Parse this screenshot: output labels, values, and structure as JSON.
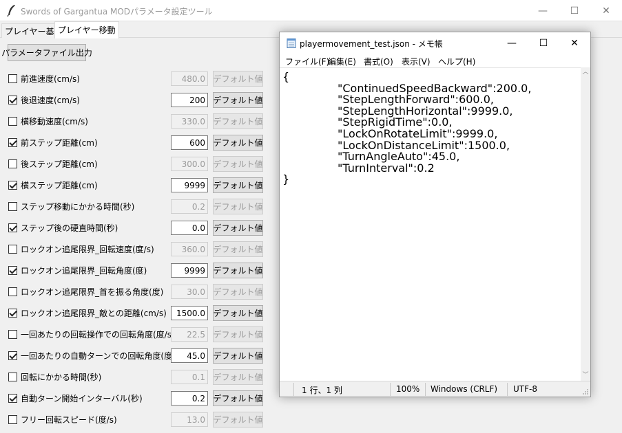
{
  "app": {
    "title": "Swords of Gargantua MODパラメータ設定ツール",
    "minimize": "—",
    "maximize": "☐",
    "close": "✕"
  },
  "tabs": [
    {
      "label": "プレイヤー基礎"
    },
    {
      "label": "プレイヤー移動"
    }
  ],
  "export_button": "パラメータファイル出力",
  "default_label": "デフォルト値",
  "params": [
    {
      "label": "前進速度(cm/s)",
      "checked": false,
      "value": "480.0"
    },
    {
      "label": "後退速度(cm/s)",
      "checked": true,
      "value": "200"
    },
    {
      "label": "横移動速度(cm/s)",
      "checked": false,
      "value": "330.0"
    },
    {
      "label": "前ステップ距離(cm)",
      "checked": true,
      "value": "600"
    },
    {
      "label": "後ステップ距離(cm)",
      "checked": false,
      "value": "300.0"
    },
    {
      "label": "横ステップ距離(cm)",
      "checked": true,
      "value": "9999"
    },
    {
      "label": "ステップ移動にかかる時間(秒)",
      "checked": false,
      "value": "0.2"
    },
    {
      "label": "ステップ後の硬直時間(秒)",
      "checked": true,
      "value": "0.0"
    },
    {
      "label": "ロックオン追尾限界_回転速度(度/s)",
      "checked": false,
      "value": "360.0"
    },
    {
      "label": "ロックオン追尾限界_回転角度(度)",
      "checked": true,
      "value": "9999"
    },
    {
      "label": "ロックオン追尾限界_首を振る角度(度)",
      "checked": false,
      "value": "30.0"
    },
    {
      "label": "ロックオン追尾限界_敵との距離(cm/s)",
      "checked": true,
      "value": "1500.0"
    },
    {
      "label": "一回あたりの回転操作での回転角度(度/s)",
      "checked": false,
      "value": "22.5"
    },
    {
      "label": "一回あたりの自動ターンでの回転角度(度/s)",
      "checked": true,
      "value": "45.0"
    },
    {
      "label": "回転にかかる時間(秒)",
      "checked": false,
      "value": "0.1"
    },
    {
      "label": "自動ターン開始インターバル(秒)",
      "checked": true,
      "value": "0.2"
    },
    {
      "label": "フリー回転スピード(度/s)",
      "checked": false,
      "value": "13.0"
    }
  ],
  "notepad": {
    "title": "playermovement_test.json - メモ帳",
    "menu": [
      "ファイル(F)",
      "編集(E)",
      "書式(O)",
      "表示(V)",
      "ヘルプ(H)"
    ],
    "lines": [
      "{",
      "\t\t\"ContinuedSpeedBackward\":200.0,",
      "\t\t\"StepLengthForward\":600.0,",
      "\t\t\"StepLengthHorizontal\":9999.0,",
      "\t\t\"StepRigidTime\":0.0,",
      "\t\t\"LockOnRotateLimit\":9999.0,",
      "\t\t\"LockOnDistanceLimit\":1500.0,",
      "\t\t\"TurnAngleAuto\":45.0,",
      "\t\t\"TurnInterval\":0.2",
      "}"
    ],
    "status": {
      "position": "1 行、1 列",
      "zoom": "100%",
      "line_ending": "Windows (CRLF)",
      "encoding": "UTF-8"
    }
  }
}
